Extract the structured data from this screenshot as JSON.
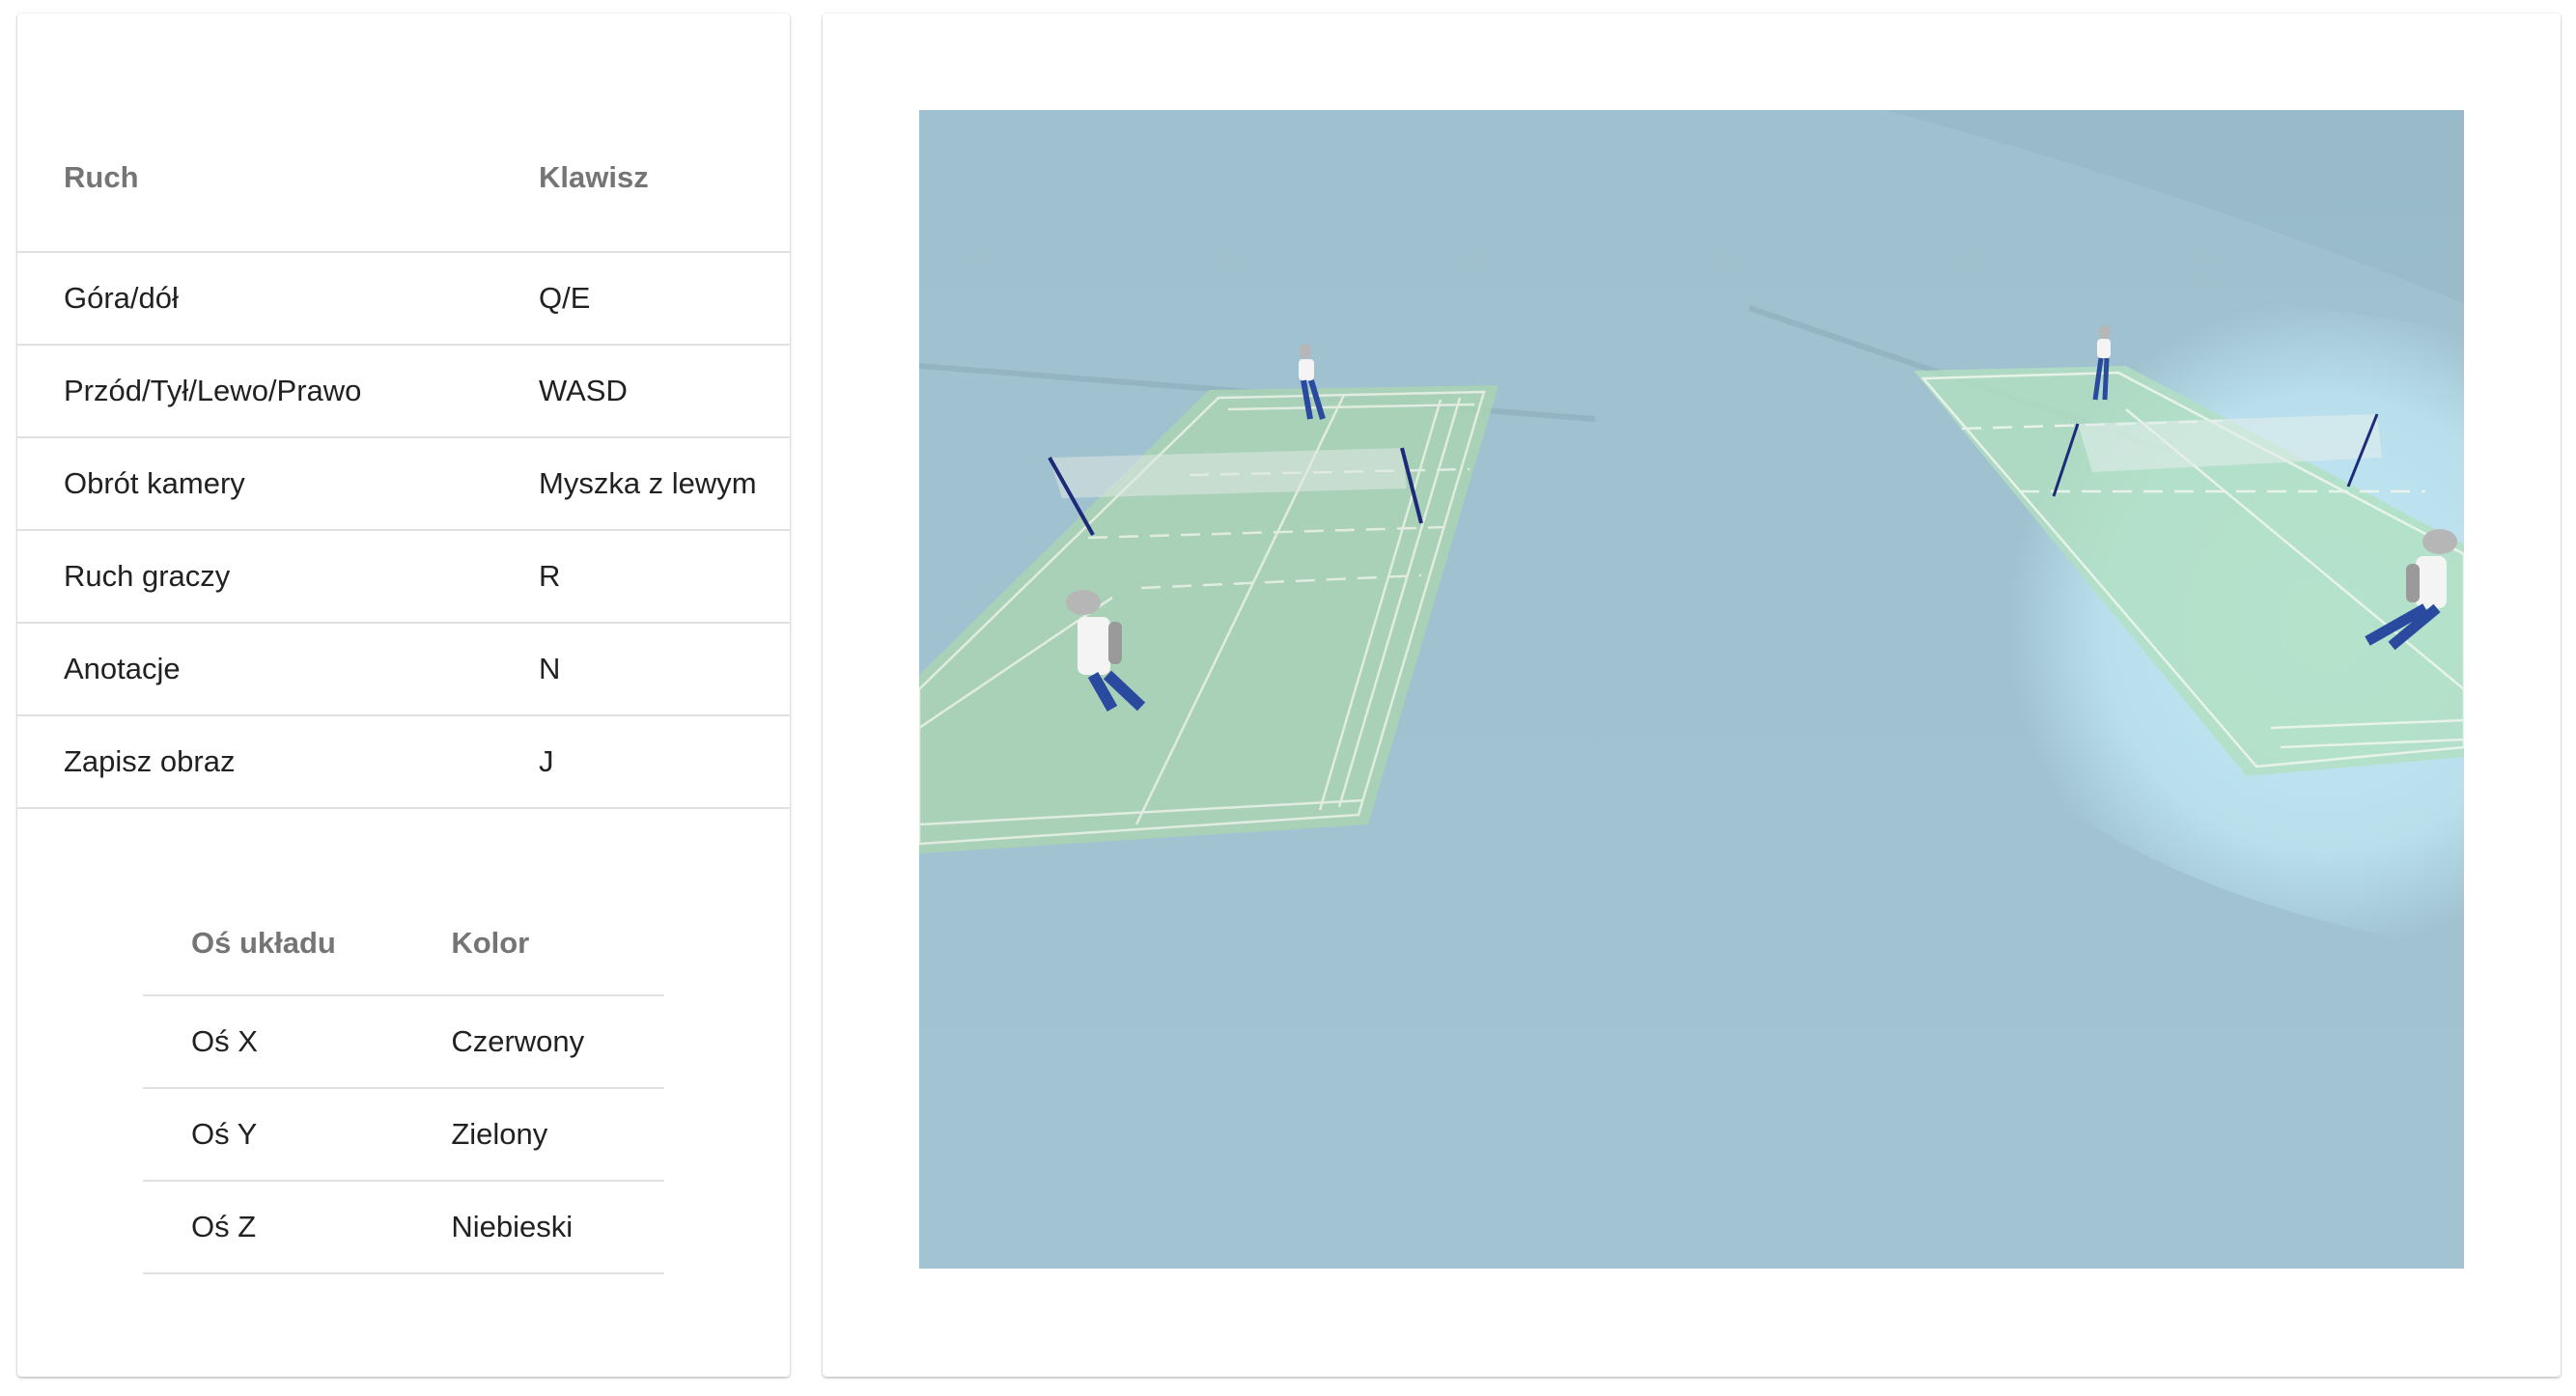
{
  "controls_table": {
    "headers": {
      "action": "Ruch",
      "key": "Klawisz"
    },
    "rows": [
      {
        "action": "Góra/dół",
        "key": "Q/E"
      },
      {
        "action": "Przód/Tył/Lewo/Prawo",
        "key": "WASD"
      },
      {
        "action": "Obrót kamery",
        "key": "Myszka z lewym"
      },
      {
        "action": "Ruch graczy",
        "key": "R"
      },
      {
        "action": "Anotacje",
        "key": "N"
      },
      {
        "action": "Zapisz obraz",
        "key": "J"
      }
    ]
  },
  "axes_table": {
    "headers": {
      "axis": "Oś układu",
      "color": "Kolor"
    },
    "rows": [
      {
        "axis": "Oś X",
        "color": "Czerwony"
      },
      {
        "axis": "Oś Y",
        "color": "Zielony"
      },
      {
        "axis": "Oś Z",
        "color": "Niebieski"
      }
    ]
  },
  "scene": {
    "background_color": "#a0c2d0",
    "court_color": "#a9d4b4",
    "spotlight_color": "#c3ecf7",
    "player_shirt": "#f4f4f4",
    "player_pants": "#2a4aa0",
    "net_pole_color": "#1d2a78"
  }
}
